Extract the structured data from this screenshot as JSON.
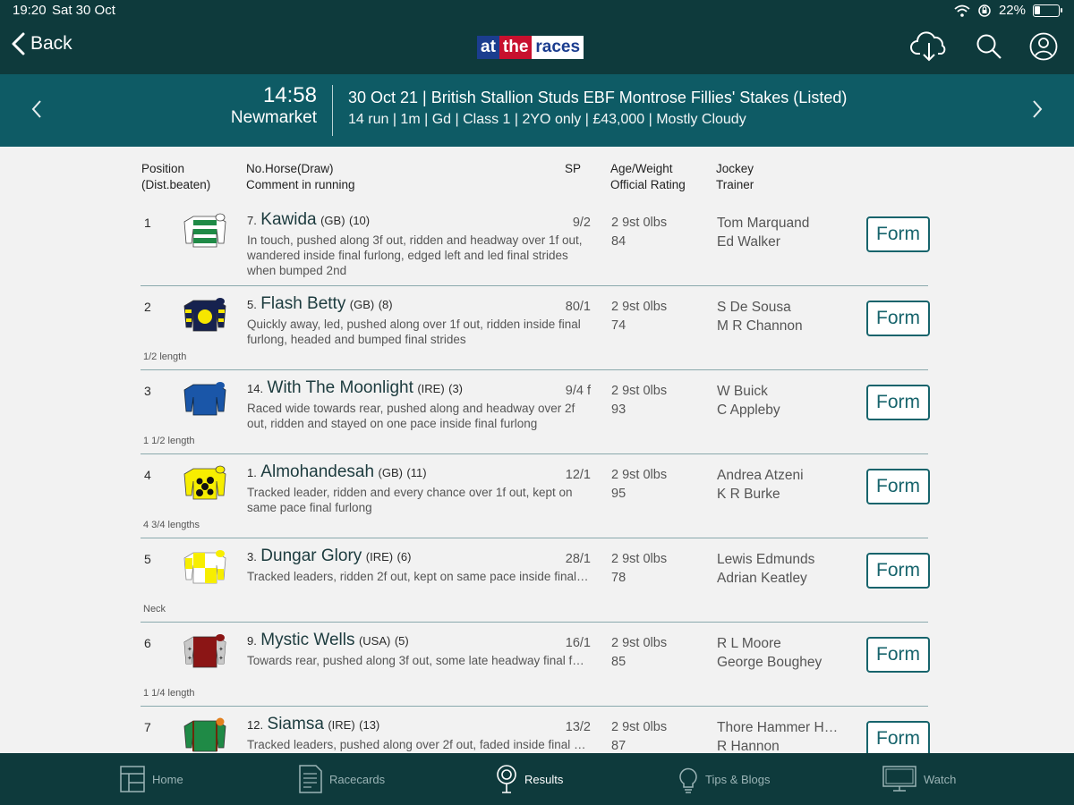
{
  "status": {
    "time": "19:20",
    "date": "Sat 30 Oct",
    "battery": "22%",
    "battery_level": 0.22
  },
  "nav": {
    "back_label": "Back",
    "logo": [
      "at",
      "the",
      "races"
    ]
  },
  "race": {
    "time": "14:58",
    "course": "Newmarket",
    "title": "30 Oct 21 | British Stallion Studs EBF Montrose Fillies' Stakes (Listed)",
    "details": "14 run | 1m | Gd | Class 1 | 2YO only | £43,000 | Mostly Cloudy"
  },
  "columns": {
    "position": "Position",
    "dist_beaten": "(Dist.beaten)",
    "horse": "No.Horse(Draw)",
    "comment": "Comment in running",
    "sp": "SP",
    "age_weight": "Age/Weight",
    "rating": "Official Rating",
    "jockey": "Jockey",
    "trainer": "Trainer"
  },
  "form_label": "Form",
  "runners": [
    {
      "pos": "1",
      "dist": "",
      "num": "7.",
      "name": "Kawida",
      "country": "(GB)",
      "draw": "(10)",
      "comment": "In touch, pushed along 3f out, ridden and headway over 1f out, wandered inside final furlong, edged left and led final strides when bumped 2nd",
      "sp": "9/2",
      "weight": "2 9st 0lbs",
      "rating": "84",
      "jockey": "Tom Marquand",
      "trainer": "Ed Walker",
      "silk": "green-hoops"
    },
    {
      "pos": "2",
      "dist": "1/2 length",
      "num": "5.",
      "name": "Flash Betty",
      "country": "(GB)",
      "draw": "(8)",
      "comment": "Quickly away, led, pushed along over 1f out, ridden inside final furlong, headed and bumped final strides",
      "sp": "80/1",
      "weight": "2 9st 0lbs",
      "rating": "74",
      "jockey": "S De Sousa",
      "trainer": "M R Channon",
      "silk": "navy-yellow-disc"
    },
    {
      "pos": "3",
      "dist": "1 1/2 length",
      "num": "14.",
      "name": "With The Moonlight",
      "country": "(IRE)",
      "draw": "(3)",
      "comment": "Raced wide towards rear, pushed along and headway over 2f out, ridden and stayed on one pace inside final furlong",
      "sp": "9/4 f",
      "weight": "2 9st 0lbs",
      "rating": "93",
      "jockey": "W Buick",
      "trainer": "C Appleby",
      "silk": "royal-blue"
    },
    {
      "pos": "4",
      "dist": "4 3/4 lengths",
      "num": "1.",
      "name": "Almohandesah",
      "country": "(GB)",
      "draw": "(11)",
      "comment": "Tracked leader, ridden and every chance over 1f out, kept on same pace final furlong",
      "sp": "12/1",
      "weight": "2 9st 0lbs",
      "rating": "95",
      "jockey": "Andrea Atzeni",
      "trainer": "K R Burke",
      "silk": "yellow-black-spots"
    },
    {
      "pos": "5",
      "dist": "Neck",
      "num": "3.",
      "name": "Dungar Glory",
      "country": "(IRE)",
      "draw": "(6)",
      "comment": "Tracked leaders, ridden 2f out, kept on same pace inside final furl…",
      "sp": "28/1",
      "weight": "2 9st 0lbs",
      "rating": "78",
      "jockey": "Lewis Edmunds",
      "trainer": "Adrian Keatley",
      "silk": "yellow-white-quartered"
    },
    {
      "pos": "6",
      "dist": "1 1/4 length",
      "num": "9.",
      "name": "Mystic Wells",
      "country": "(USA)",
      "draw": "(5)",
      "comment": "Towards rear, pushed along 3f out, some late headway final furl…",
      "sp": "16/1",
      "weight": "2 9st 0lbs",
      "rating": "85",
      "jockey": "R L Moore",
      "trainer": "George Boughey",
      "silk": "maroon-grey-stars"
    },
    {
      "pos": "7",
      "dist": "",
      "num": "12.",
      "name": "Siamsa",
      "country": "(IRE)",
      "draw": "(13)",
      "comment": "Tracked leaders, pushed along over 2f out, faded inside final furl…",
      "sp": "13/2",
      "weight": "2 9st 0lbs",
      "rating": "87",
      "jockey": "Thore Hammer Ha…",
      "trainer": "R Hannon",
      "silk": "green-orange-braid"
    }
  ],
  "tabs": [
    {
      "label": "Home",
      "icon": "home-icon"
    },
    {
      "label": "Racecards",
      "icon": "racecard-icon"
    },
    {
      "label": "Results",
      "icon": "results-icon",
      "active": true
    },
    {
      "label": "Tips & Blogs",
      "icon": "lightbulb-icon"
    },
    {
      "label": "Watch",
      "icon": "tv-icon"
    }
  ],
  "colors": {
    "header_dark": "#0e3a3c",
    "header_race": "#0e5b65",
    "accent": "#17646c",
    "background": "#f2f2f2"
  }
}
